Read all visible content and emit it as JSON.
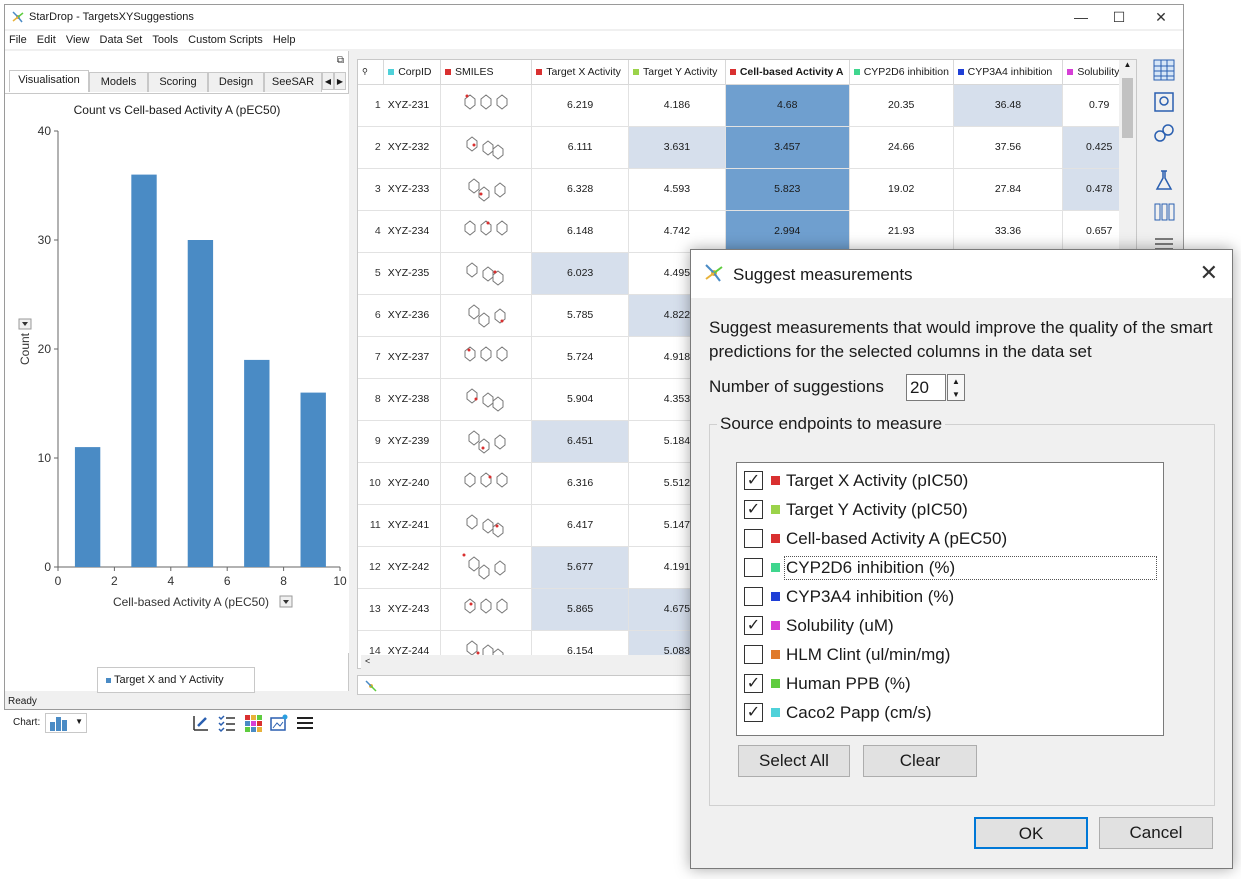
{
  "window": {
    "title": "StarDrop - TargetsXYSuggestions",
    "menu": [
      "File",
      "Edit",
      "View",
      "Data Set",
      "Tools",
      "Custom Scripts",
      "Help"
    ],
    "status": "Ready"
  },
  "left_panel": {
    "tabs": [
      "Visualisation",
      "Models",
      "Scoring",
      "Design",
      "SeeSAR"
    ],
    "active_tab": "Visualisation",
    "chart_label": "Chart:",
    "legend": "Target X and Y Activity"
  },
  "chart_data": {
    "type": "bar",
    "title": "Count vs Cell-based Activity A (pEC50)",
    "xlabel": "Cell-based Activity A (pEC50)",
    "ylabel": "Count",
    "xlim": [
      0,
      10
    ],
    "ylim": [
      0,
      40
    ],
    "xticks": [
      0,
      2,
      4,
      6,
      8,
      10
    ],
    "yticks": [
      0,
      10,
      20,
      30,
      40
    ],
    "bins": [
      {
        "x0": 0.6,
        "x1": 1.5,
        "value": 11
      },
      {
        "x0": 2.6,
        "x1": 3.5,
        "value": 36
      },
      {
        "x0": 4.6,
        "x1": 5.5,
        "value": 30
      },
      {
        "x0": 6.6,
        "x1": 7.5,
        "value": 19
      },
      {
        "x0": 8.6,
        "x1": 9.5,
        "value": 16
      }
    ],
    "series_name": "Target X and Y Activity",
    "color": "#4a8bc5"
  },
  "grid": {
    "columns": [
      {
        "label": "CorpID",
        "color": "#4fd1d9"
      },
      {
        "label": "SMILES",
        "color": "#d93030"
      },
      {
        "label": "Target X Activity",
        "color": "#d93030"
      },
      {
        "label": "Target Y Activity",
        "color": "#9bd34a"
      },
      {
        "label": "Cell-based Activity A",
        "color": "#d93030",
        "bold": true
      },
      {
        "label": "CYP2D6 inhibition",
        "color": "#3fd68e"
      },
      {
        "label": "CYP3A4 inhibition",
        "color": "#1f3fd6"
      },
      {
        "label": "Solubility",
        "color": "#d63fd6"
      }
    ],
    "rows": [
      {
        "n": "1",
        "id": "XYZ-231",
        "tx": "6.219",
        "ty": "4.186",
        "cb": "4.68",
        "c2": "20.35",
        "c3": "36.48",
        "sol": "0.79",
        "hl": [
          "cb",
          "c3"
        ]
      },
      {
        "n": "2",
        "id": "XYZ-232",
        "tx": "6.111",
        "ty": "3.631",
        "cb": "3.457",
        "c2": "24.66",
        "c3": "37.56",
        "sol": "0.425",
        "hl": [
          "ty",
          "cb",
          "sol"
        ]
      },
      {
        "n": "3",
        "id": "XYZ-233",
        "tx": "6.328",
        "ty": "4.593",
        "cb": "5.823",
        "c2": "19.02",
        "c3": "27.84",
        "sol": "0.478",
        "hl": [
          "cb",
          "sol"
        ]
      },
      {
        "n": "4",
        "id": "XYZ-234",
        "tx": "6.148",
        "ty": "4.742",
        "cb": "2.994",
        "c2": "21.93",
        "c3": "33.36",
        "sol": "0.657",
        "hl": [
          "cb"
        ]
      },
      {
        "n": "5",
        "id": "XYZ-235",
        "tx": "6.023",
        "ty": "4.495",
        "cb": "",
        "c2": "",
        "c3": "",
        "sol": "",
        "hl": [
          "tx",
          "cb"
        ]
      },
      {
        "n": "6",
        "id": "XYZ-236",
        "tx": "5.785",
        "ty": "4.822",
        "cb": "",
        "c2": "",
        "c3": "",
        "sol": "",
        "hl": [
          "ty"
        ]
      },
      {
        "n": "7",
        "id": "XYZ-237",
        "tx": "5.724",
        "ty": "4.918",
        "cb": "",
        "c2": "",
        "c3": "",
        "sol": "",
        "hl": []
      },
      {
        "n": "8",
        "id": "XYZ-238",
        "tx": "5.904",
        "ty": "4.353",
        "cb": "",
        "c2": "",
        "c3": "",
        "sol": "",
        "hl": []
      },
      {
        "n": "9",
        "id": "XYZ-239",
        "tx": "6.451",
        "ty": "5.184",
        "cb": "",
        "c2": "",
        "c3": "",
        "sol": "",
        "hl": [
          "tx"
        ]
      },
      {
        "n": "10",
        "id": "XYZ-240",
        "tx": "6.316",
        "ty": "5.512",
        "cb": "",
        "c2": "",
        "c3": "",
        "sol": "",
        "hl": []
      },
      {
        "n": "11",
        "id": "XYZ-241",
        "tx": "6.417",
        "ty": "5.147",
        "cb": "",
        "c2": "",
        "c3": "",
        "sol": "",
        "hl": []
      },
      {
        "n": "12",
        "id": "XYZ-242",
        "tx": "5.677",
        "ty": "4.191",
        "cb": "",
        "c2": "",
        "c3": "",
        "sol": "",
        "hl": [
          "tx"
        ]
      },
      {
        "n": "13",
        "id": "XYZ-243",
        "tx": "5.865",
        "ty": "4.675",
        "cb": "",
        "c2": "",
        "c3": "",
        "sol": "",
        "hl": [
          "tx",
          "ty"
        ]
      },
      {
        "n": "14",
        "id": "XYZ-244",
        "tx": "6.154",
        "ty": "5.083",
        "cb": "",
        "c2": "",
        "c3": "",
        "sol": "",
        "hl": [
          "ty"
        ]
      }
    ]
  },
  "dialog": {
    "title": "Suggest measurements",
    "description": "Suggest measurements that would improve the quality of the smart predictions for the selected columns in the data set",
    "num_label": "Number of suggestions",
    "num_value": "20",
    "group_title": "Source endpoints to measure",
    "endpoints": [
      {
        "label": "Target X Activity (pIC50)",
        "checked": true,
        "color": "#d93030"
      },
      {
        "label": "Target Y Activity (pIC50)",
        "checked": true,
        "color": "#9bd34a"
      },
      {
        "label": "Cell-based Activity A (pEC50)",
        "checked": false,
        "color": "#d93030"
      },
      {
        "label": "CYP2D6 inhibition (%)",
        "checked": false,
        "color": "#3fd68e",
        "focus": true
      },
      {
        "label": "CYP3A4 inhibition (%)",
        "checked": false,
        "color": "#1f3fd6"
      },
      {
        "label": "Solubility (uM)",
        "checked": true,
        "color": "#d63fd6"
      },
      {
        "label": "HLM Clint (ul/min/mg)",
        "checked": false,
        "color": "#e07a2a"
      },
      {
        "label": "Human PPB (%)",
        "checked": true,
        "color": "#5fcc3f"
      },
      {
        "label": "Caco2 Papp (cm/s)",
        "checked": true,
        "color": "#4fd1d9"
      }
    ],
    "select_all": "Select All",
    "clear": "Clear",
    "ok": "OK",
    "cancel": "Cancel"
  }
}
